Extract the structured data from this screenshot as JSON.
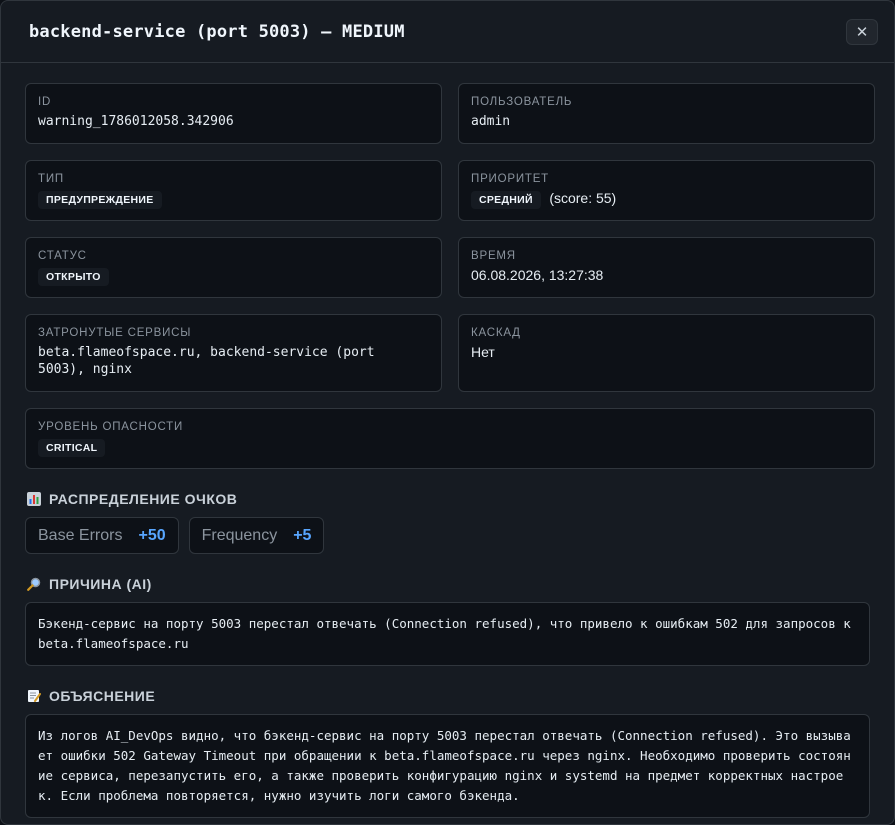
{
  "header": {
    "title": "backend-service (port 5003) — MEDIUM",
    "close_label": "✕"
  },
  "fields": {
    "id": {
      "label": "ID",
      "value": "warning_1786012058.342906"
    },
    "user": {
      "label": "ПОЛЬЗОВАТЕЛЬ",
      "value": "admin"
    },
    "type": {
      "label": "ТИП",
      "value": "ПРЕДУПРЕЖДЕНИЕ"
    },
    "priority": {
      "label": "ПРИОРИТЕТ",
      "value": "СРЕДНИЙ",
      "score": "(score: 55)"
    },
    "status": {
      "label": "СТАТУС",
      "value": "ОТКРЫТО"
    },
    "time": {
      "label": "ВРЕМЯ",
      "value": "06.08.2026, 13:27:38"
    },
    "services": {
      "label": "ЗАТРОНУТЫЕ СЕРВИСЫ",
      "value": "beta.flameofspace.ru, backend-service (port 5003), nginx"
    },
    "cascade": {
      "label": "КАСКАД",
      "value": "Нет"
    },
    "severity": {
      "label": "УРОВЕНЬ ОПАСНОСТИ",
      "value": "CRITICAL"
    }
  },
  "score_distribution": {
    "title": "РАСПРЕДЕЛЕНИЕ ОЧКОВ",
    "icon": "bar-chart-icon",
    "items": [
      {
        "name": "Base Errors",
        "value": "+50"
      },
      {
        "name": "Frequency",
        "value": "+5"
      }
    ]
  },
  "cause": {
    "title": "ПРИЧИНА (AI)",
    "icon": "magnifier-icon",
    "text": "Бэкенд-сервис на порту 5003 перестал отвечать (Connection refused), что привело к ошибкам 502 для запросов к beta.flameofspace.ru"
  },
  "explanation": {
    "title": "ОБЪЯСНЕНИЕ",
    "icon": "memo-icon",
    "text": "Из логов AI_DevOps видно, что бэкенд-сервис на порту 5003 перестал отвечать (Connection refused). Это вызывает ошибки 502 Gateway Timeout при обращении к beta.flameofspace.ru через nginx. Необходимо проверить состояние сервиса, перезапустить его, а также проверить конфигурацию nginx и systemd на предмет корректных настроек. Если проблема повторяется, нужно изучить логи самого бэкенда."
  },
  "colors": {
    "background": "#161b22",
    "card": "#0d1117",
    "border": "#30363d",
    "accent": "#58a6ff"
  }
}
